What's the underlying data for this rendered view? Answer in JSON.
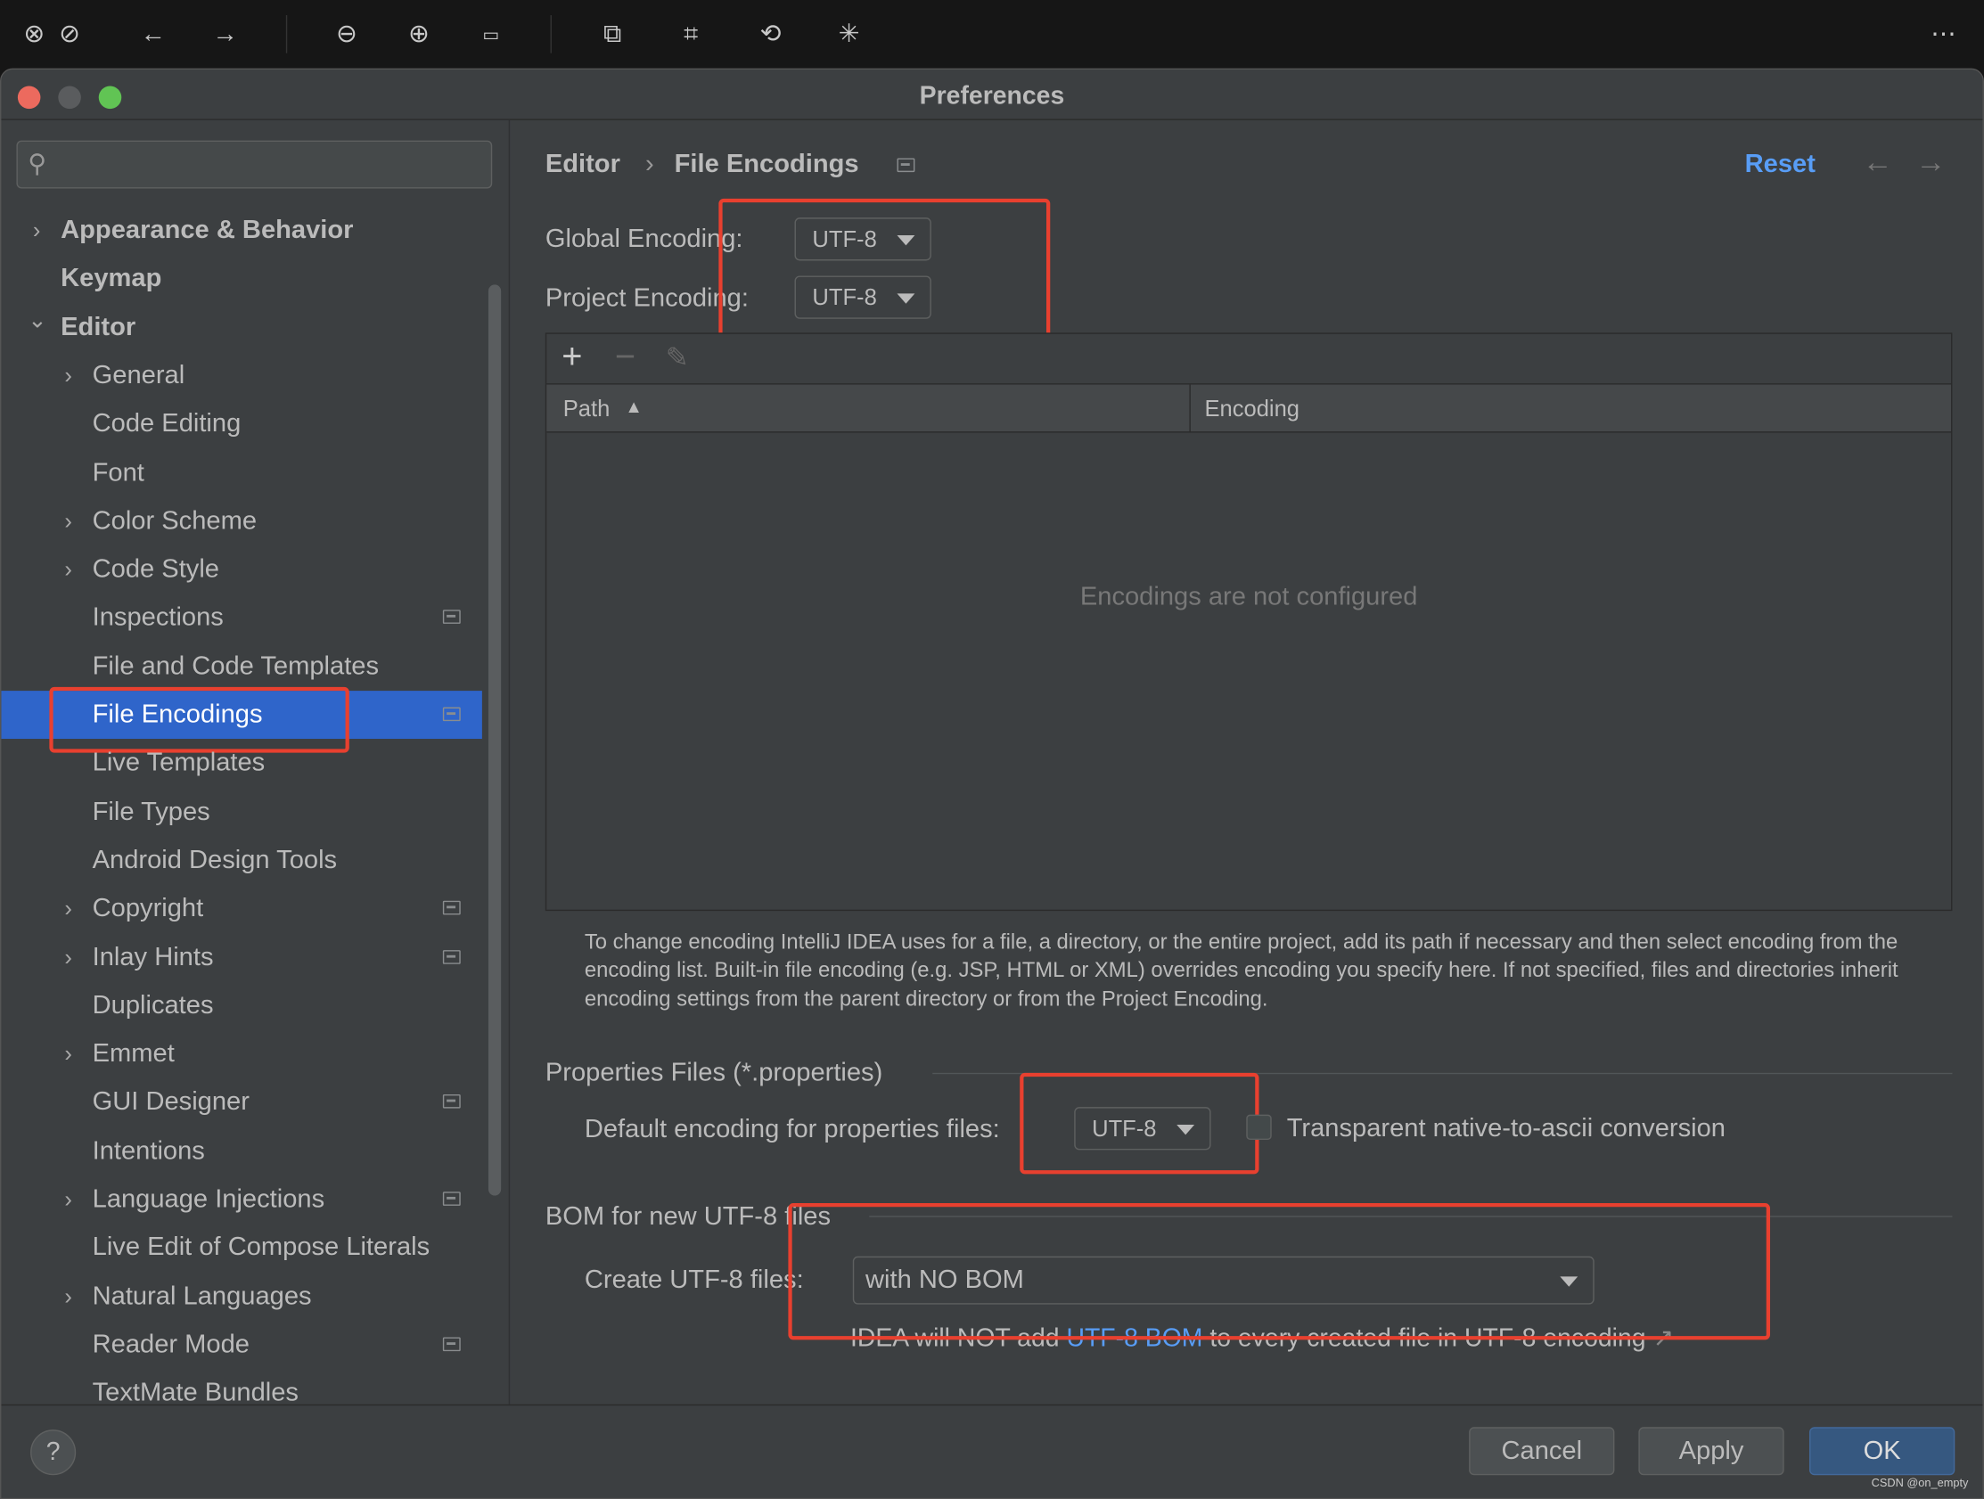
{
  "viewer_toolbar": {
    "icons": [
      "close-circle-icon",
      "block-icon",
      "back-arrow-icon",
      "forward-arrow-icon",
      "zoom-out-icon",
      "zoom-in-icon",
      "actual-size-icon",
      "translate-icon",
      "scan-text-icon",
      "rotate-icon",
      "magic-wand-icon",
      "more-icon"
    ]
  },
  "window": {
    "title": "Preferences"
  },
  "sidebar": {
    "search_placeholder": "",
    "items": [
      {
        "label": "Appearance & Behavior",
        "level": 0,
        "expandable": true,
        "expanded": false,
        "bold": true
      },
      {
        "label": "Keymap",
        "level": 0,
        "expandable": false,
        "bold": true
      },
      {
        "label": "Editor",
        "level": 0,
        "expandable": true,
        "expanded": true,
        "bold": true
      },
      {
        "label": "General",
        "level": 1,
        "expandable": true
      },
      {
        "label": "Code Editing",
        "level": 1
      },
      {
        "label": "Font",
        "level": 1
      },
      {
        "label": "Color Scheme",
        "level": 1,
        "expandable": true
      },
      {
        "label": "Code Style",
        "level": 1,
        "expandable": true
      },
      {
        "label": "Inspections",
        "level": 1,
        "badge": true
      },
      {
        "label": "File and Code Templates",
        "level": 1
      },
      {
        "label": "File Encodings",
        "level": 1,
        "badge": true,
        "selected": true
      },
      {
        "label": "Live Templates",
        "level": 1
      },
      {
        "label": "File Types",
        "level": 1
      },
      {
        "label": "Android Design Tools",
        "level": 1
      },
      {
        "label": "Copyright",
        "level": 1,
        "expandable": true,
        "badge": true
      },
      {
        "label": "Inlay Hints",
        "level": 1,
        "expandable": true,
        "badge": true
      },
      {
        "label": "Duplicates",
        "level": 1
      },
      {
        "label": "Emmet",
        "level": 1,
        "expandable": true
      },
      {
        "label": "GUI Designer",
        "level": 1,
        "badge": true
      },
      {
        "label": "Intentions",
        "level": 1
      },
      {
        "label": "Language Injections",
        "level": 1,
        "expandable": true,
        "badge": true
      },
      {
        "label": "Live Edit of Compose Literals",
        "level": 1
      },
      {
        "label": "Natural Languages",
        "level": 1,
        "expandable": true
      },
      {
        "label": "Reader Mode",
        "level": 1,
        "badge": true
      },
      {
        "label": "TextMate Bundles",
        "level": 1
      }
    ]
  },
  "header": {
    "breadcrumb": [
      "Editor",
      "File Encodings"
    ],
    "reset_label": "Reset"
  },
  "encodings": {
    "global_label": "Global Encoding:",
    "global_value": "UTF-8",
    "project_label": "Project Encoding:",
    "project_value": "UTF-8",
    "table": {
      "columns": [
        "Path",
        "Encoding"
      ],
      "empty_text": "Encodings are not configured"
    },
    "help_text": "To change encoding IntelliJ IDEA uses for a file, a directory, or the entire project, add its path if necessary and then select encoding from the encoding list. Built-in file encoding (e.g. JSP, HTML or XML) overrides encoding you specify here. If not specified, files and directories inherit encoding settings from the parent directory or from the Project Encoding."
  },
  "properties": {
    "section_title": "Properties Files (*.properties)",
    "default_label": "Default encoding for properties files:",
    "default_value": "UTF-8",
    "transparent_label": "Transparent native-to-ascii conversion",
    "transparent_checked": false
  },
  "bom": {
    "section_title": "BOM for new UTF-8 files",
    "create_label": "Create UTF-8 files:",
    "create_value": "with NO BOM",
    "note_prefix": "IDEA will NOT add ",
    "note_link": "UTF-8 BOM",
    "note_suffix": " to every created file in UTF-8 encoding",
    "note_arrow": "↗"
  },
  "footer": {
    "help": "?",
    "cancel": "Cancel",
    "apply": "Apply",
    "ok": "OK"
  },
  "watermark": "CSDN @on_empty",
  "colors": {
    "accent": "#2f65ca",
    "link": "#589df6",
    "highlight_box": "#e8402f",
    "ok_button": "#365880"
  }
}
